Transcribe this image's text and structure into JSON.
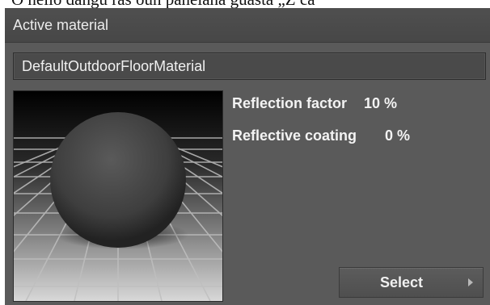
{
  "page_top_text": "O nello dangu ras oun panelana guasta „Z ca",
  "panel": {
    "title": "Active material",
    "material_name": "DefaultOutdoorFloorMaterial"
  },
  "properties": [
    {
      "label": "Reflection factor",
      "value": "10 %"
    },
    {
      "label": "Reflective coating",
      "value": "0 %"
    }
  ],
  "select_button": {
    "label": "Select",
    "icon": "arrow-right-icon"
  },
  "colors": {
    "panel_bg": "#5a5a5a",
    "header_bg": "#4b4b4b",
    "text": "#f0f0f0"
  }
}
